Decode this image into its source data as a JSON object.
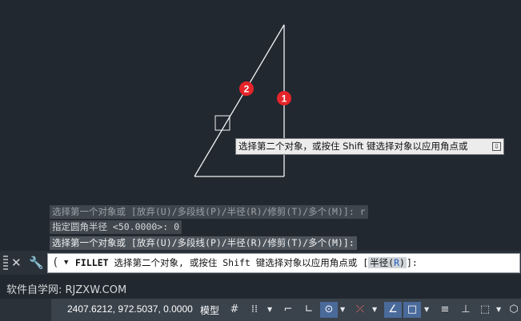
{
  "drawing": {
    "marker_1": "1",
    "marker_2": "2"
  },
  "tooltip": {
    "text": "选择第二个对象，或按住 Shift 键选择对象以应用角点或"
  },
  "history": {
    "line1": "选择第一个对象或 [放弃(U)/多段线(P)/半径(R)/修剪(T)/多个(M)]: r",
    "line2": "指定圆角半径 <50.0000>: 0",
    "line3": "选择第一个对象或 [放弃(U)/多段线(P)/半径(R)/修剪(T)/多个(M)]:"
  },
  "command": {
    "name": "FILLET",
    "prompt": " 选择第二个对象, 或按住 Shift 键选择对象以应用角点或 ",
    "option_open": "[",
    "option_label": "半径(",
    "option_key": "R",
    "option_close": ")",
    "suffix": "]:"
  },
  "brand": {
    "text": "软件自学网: RJZXW.COM"
  },
  "status": {
    "coordinates": "2407.6212, 972.5037, 0.0000",
    "model": "模型"
  }
}
